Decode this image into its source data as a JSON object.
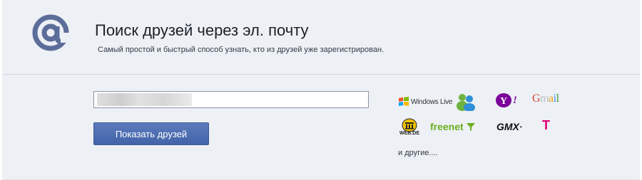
{
  "header": {
    "title": "Поиск друзей через эл. почту",
    "subtitle": "Самый простой и быстрый способ узнать, кто из друзей уже зарегистрирован.",
    "icon": "at-sign-icon"
  },
  "form": {
    "email_value": "",
    "submit_label": "Показать друзей"
  },
  "providers": {
    "windows_live": "Windows Live",
    "yahoo": "Y!",
    "gmail": "Gmail",
    "webde": "WEB.DE",
    "freenet": "freenet",
    "gmx": "GMX",
    "telekom": "T",
    "more_label": "и другие...."
  },
  "colors": {
    "panel_bg": "#edf0f5",
    "button_bg": "#4a69ad",
    "icon_color": "#5c6d99"
  }
}
